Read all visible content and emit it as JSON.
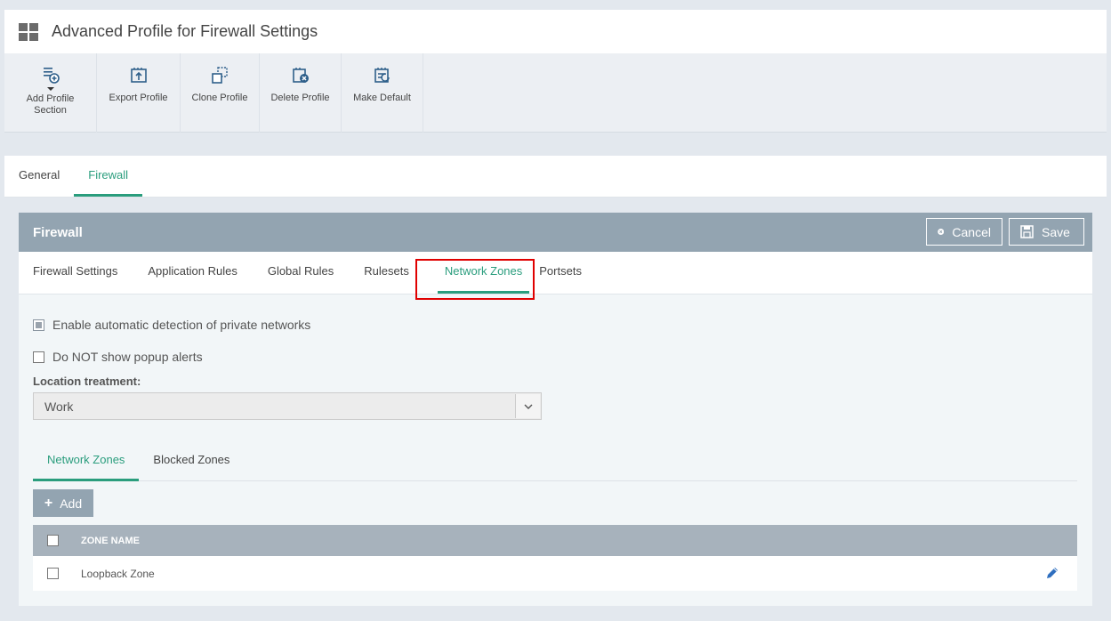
{
  "header": {
    "title": "Advanced Profile for Firewall Settings"
  },
  "toolbar": {
    "items": [
      {
        "label": "Add Profile Section",
        "icon": "add-section-icon"
      },
      {
        "label": "Export Profile",
        "icon": "export-icon"
      },
      {
        "label": "Clone Profile",
        "icon": "clone-icon"
      },
      {
        "label": "Delete Profile",
        "icon": "delete-icon"
      },
      {
        "label": "Make Default",
        "icon": "make-default-icon"
      }
    ]
  },
  "top_tabs": [
    {
      "label": "General",
      "active": false
    },
    {
      "label": "Firewall",
      "active": true
    }
  ],
  "panel": {
    "title": "Firewall",
    "cancel_label": "Cancel",
    "save_label": "Save",
    "tabs": [
      {
        "label": "Firewall Settings"
      },
      {
        "label": "Application Rules"
      },
      {
        "label": "Global Rules"
      },
      {
        "label": "Rulesets"
      },
      {
        "label": "Network Zones",
        "active": true
      },
      {
        "label": "Portsets"
      }
    ],
    "options": {
      "auto_detect_label": "Enable automatic detection of private networks",
      "no_popup_label": "Do NOT show popup alerts"
    },
    "location": {
      "label": "Location treatment:",
      "value": "Work"
    },
    "inner_tabs": [
      {
        "label": "Network Zones",
        "active": true
      },
      {
        "label": "Blocked Zones"
      }
    ],
    "add_label": "Add",
    "table": {
      "column": "ZONE NAME",
      "rows": [
        {
          "name": "Loopback Zone"
        }
      ]
    }
  },
  "colors": {
    "accent": "#2a9d7d",
    "panel_header": "#93a4b1",
    "highlight": "#e00000"
  }
}
